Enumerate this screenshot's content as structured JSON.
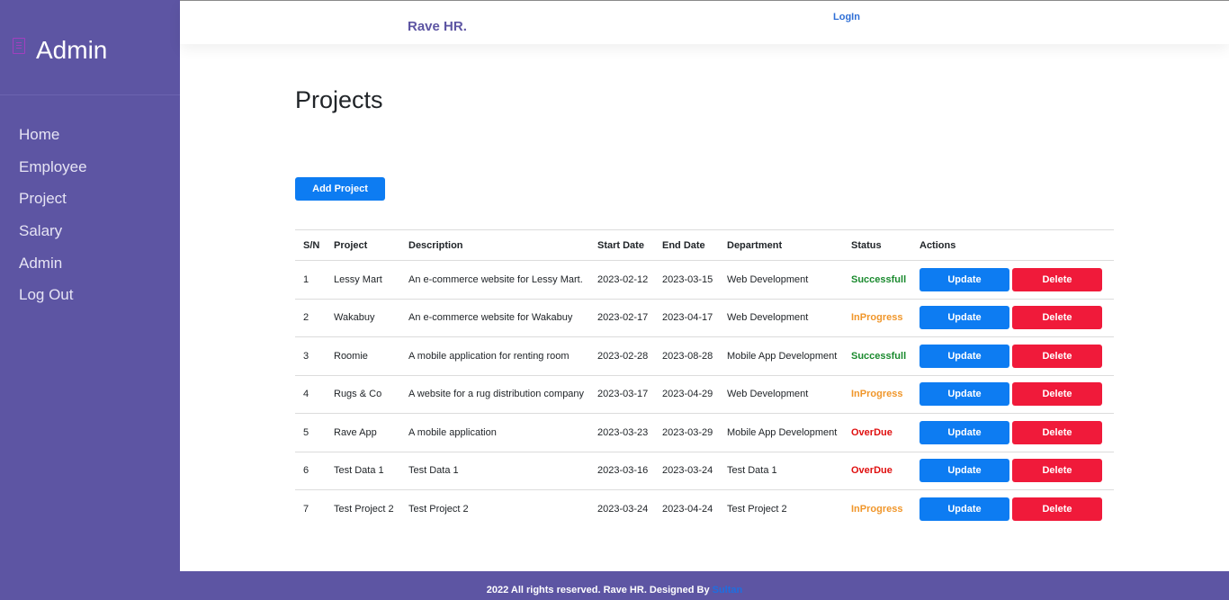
{
  "sidebar": {
    "title": "Admin",
    "items": [
      {
        "label": "Home"
      },
      {
        "label": "Employee"
      },
      {
        "label": "Project"
      },
      {
        "label": "Salary"
      },
      {
        "label": "Admin"
      },
      {
        "label": "Log Out"
      }
    ]
  },
  "header": {
    "brand": "Rave HR.",
    "login_label": "LogIn"
  },
  "main": {
    "title": "Projects",
    "add_button": "Add Project",
    "columns": [
      "S/N",
      "Project",
      "Description",
      "Start Date",
      "End Date",
      "Department",
      "Status",
      "Actions"
    ],
    "update_label": "Update",
    "delete_label": "Delete",
    "rows": [
      {
        "sn": "1",
        "project": "Lessy Mart",
        "description": "An e-commerce website for Lessy Mart.",
        "start": "2023-02-12",
        "end": "2023-03-15",
        "department": "Web Development",
        "status": "Successfull"
      },
      {
        "sn": "2",
        "project": "Wakabuy",
        "description": "An e-commerce website for Wakabuy",
        "start": "2023-02-17",
        "end": "2023-04-17",
        "department": "Web Development",
        "status": "InProgress"
      },
      {
        "sn": "3",
        "project": "Roomie",
        "description": "A mobile application for renting room",
        "start": "2023-02-28",
        "end": "2023-08-28",
        "department": "Mobile App Development",
        "status": "Successfull"
      },
      {
        "sn": "4",
        "project": "Rugs & Co",
        "description": "A website for a rug distribution company",
        "start": "2023-03-17",
        "end": "2023-04-29",
        "department": "Web Development",
        "status": "InProgress"
      },
      {
        "sn": "5",
        "project": "Rave App",
        "description": "A mobile application",
        "start": "2023-03-23",
        "end": "2023-03-29",
        "department": "Mobile App Development",
        "status": "OverDue"
      },
      {
        "sn": "6",
        "project": "Test Data 1",
        "description": "Test Data 1",
        "start": "2023-03-16",
        "end": "2023-03-24",
        "department": "Test Data 1",
        "status": "OverDue"
      },
      {
        "sn": "7",
        "project": "Test Project 2",
        "description": "Test Project 2",
        "start": "2023-03-24",
        "end": "2023-04-24",
        "department": "Test Project 2",
        "status": "InProgress"
      }
    ]
  },
  "status_colors": {
    "Successfull": "#1a8a2e",
    "InProgress": "#f0962a",
    "OverDue": "#e01010"
  },
  "footer": {
    "text": "2022 All rights reserved. Rave HR. Designed By ",
    "link": "Sultan"
  },
  "colors": {
    "sidebar_bg": "#5d55a3",
    "primary": "#0d7cf2",
    "danger": "#f01a3a"
  }
}
